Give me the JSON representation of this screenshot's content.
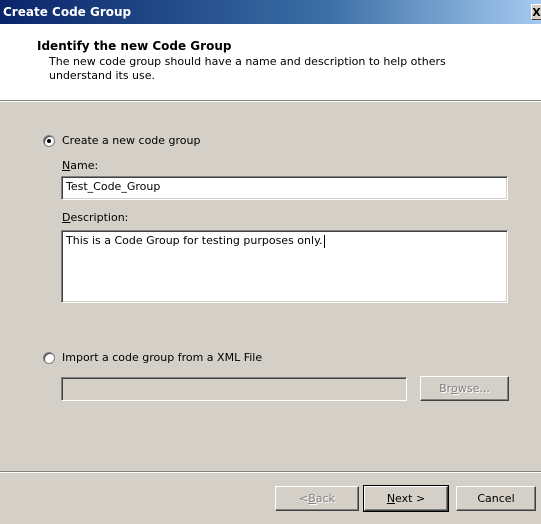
{
  "window": {
    "title": "Create Code Group",
    "close_glyph": "X"
  },
  "header": {
    "title": "Identify the new Code Group",
    "description": "The new code group should have a name and description to help others understand its use."
  },
  "option_new": {
    "label": "Create a new code group",
    "selected": true
  },
  "name": {
    "label_access": "N",
    "label_rest": "ame:",
    "value": "Test_Code_Group"
  },
  "description": {
    "label_access": "D",
    "label_rest": "escription:",
    "value": "This is a Code Group for testing purposes only."
  },
  "option_import": {
    "label": "Import a code group from a XML File",
    "selected": false,
    "file_value": ""
  },
  "buttons": {
    "browse_pre": "Br",
    "browse_access": "o",
    "browse_post": "wse...",
    "back_pre": "< ",
    "back_access": "B",
    "back_post": "ack",
    "next_access": "N",
    "next_post": "ext >",
    "cancel": "Cancel"
  }
}
